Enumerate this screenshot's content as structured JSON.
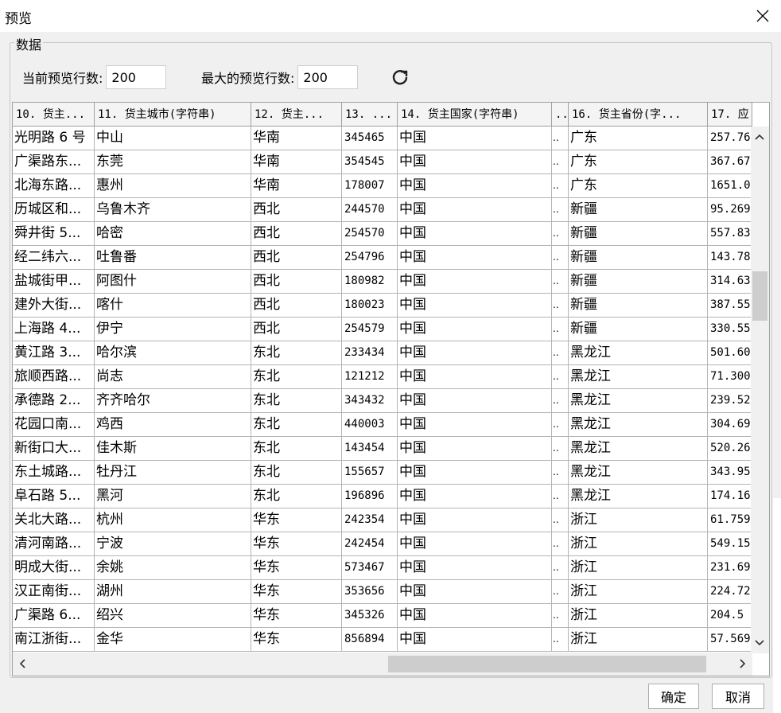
{
  "window": {
    "title": "预览"
  },
  "group_label": "数据",
  "controls": {
    "current_label": "当前预览行数:",
    "current_value": "200",
    "max_label": "最大的预览行数:",
    "max_value": "200"
  },
  "columns": [
    "10. 货主...",
    "11. 货主城市(字符串)",
    "12. 货主...",
    "13. ...",
    "14. 货主国家(字符串)",
    "..",
    "16. 货主省份(字...",
    "17. 应"
  ],
  "rows": [
    [
      "光明路 6 号",
      "中山",
      "华南",
      "345465",
      "中国",
      "..",
      "广东",
      "257.76"
    ],
    [
      "广渠路东...",
      "东莞",
      "华南",
      "354545",
      "中国",
      "..",
      "广东",
      "367.67"
    ],
    [
      "北海东路...",
      "惠州",
      "华南",
      "178007",
      "中国",
      "..",
      "广东",
      "1651.0"
    ],
    [
      "历城区和...",
      "乌鲁木齐",
      "西北",
      "244570",
      "中国",
      "..",
      "新疆",
      "95.269"
    ],
    [
      "舜井街 5...",
      "哈密",
      "西北",
      "254570",
      "中国",
      "..",
      "新疆",
      "557.83"
    ],
    [
      "经二纬六...",
      "吐鲁番",
      "西北",
      "254796",
      "中国",
      "..",
      "新疆",
      "143.78"
    ],
    [
      "盐城街甲...",
      "阿图什",
      "西北",
      "180982",
      "中国",
      "..",
      "新疆",
      "314.63"
    ],
    [
      "建外大街...",
      "喀什",
      "西北",
      "180023",
      "中国",
      "..",
      "新疆",
      "387.55"
    ],
    [
      "上海路 4...",
      "伊宁",
      "西北",
      "254579",
      "中国",
      "..",
      "新疆",
      "330.55"
    ],
    [
      "黄江路 3...",
      "哈尔滨",
      "东北",
      "233434",
      "中国",
      "..",
      "黑龙江",
      "501.60"
    ],
    [
      "旅顺西路...",
      "尚志",
      "东北",
      "121212",
      "中国",
      "..",
      "黑龙江",
      "71.300"
    ],
    [
      "承德路 2...",
      "齐齐哈尔",
      "东北",
      "343432",
      "中国",
      "..",
      "黑龙江",
      "239.52"
    ],
    [
      "花园口南...",
      "鸡西",
      "东北",
      "440003",
      "中国",
      "..",
      "黑龙江",
      "304.69"
    ],
    [
      "新街口大...",
      "佳木斯",
      "东北",
      "143454",
      "中国",
      "..",
      "黑龙江",
      "520.26"
    ],
    [
      "东土城路...",
      "牡丹江",
      "东北",
      "155657",
      "中国",
      "..",
      "黑龙江",
      "343.95"
    ],
    [
      "阜石路 5...",
      "黑河",
      "东北",
      "196896",
      "中国",
      "..",
      "黑龙江",
      "174.16"
    ],
    [
      "关北大路...",
      "杭州",
      "华东",
      "242354",
      "中国",
      "..",
      "浙江",
      "61.759"
    ],
    [
      "清河南路...",
      "宁波",
      "华东",
      "242454",
      "中国",
      "..",
      "浙江",
      "549.15"
    ],
    [
      "明成大街...",
      "余姚",
      "华东",
      "573467",
      "中国",
      "..",
      "浙江",
      "231.69"
    ],
    [
      "汉正南街...",
      "湖州",
      "华东",
      "353656",
      "中国",
      "..",
      "浙江",
      "224.72"
    ],
    [
      "广渠路 6...",
      "绍兴",
      "华东",
      "345326",
      "中国",
      "..",
      "浙江",
      "204.5"
    ],
    [
      "南江浙街...",
      "金华",
      "华东",
      "856894",
      "中国",
      "..",
      "浙江",
      "57.569"
    ]
  ],
  "buttons": {
    "ok": "确定",
    "cancel": "取消"
  },
  "colors": {
    "accent_icon": "#1f1f1f",
    "grid_line": "#b4b4b4"
  }
}
